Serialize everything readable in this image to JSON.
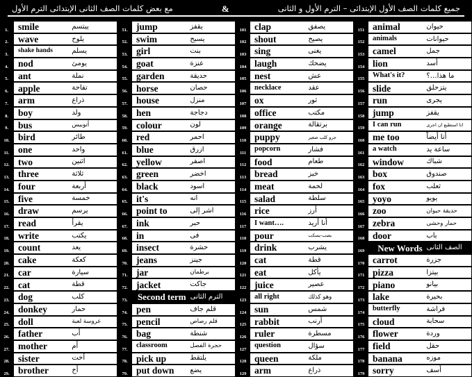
{
  "header": {
    "right_text": "جميع كلمات الصف الأول الإبتدائى – الترم الأول و الثانى",
    "amp": "&",
    "left_text": "مع بعض كلمات الصف الثانى الإبتدائى الترم الأول"
  },
  "colors": {
    "page_background": "#000000",
    "cell_background": "#ffffff",
    "text": "#000000",
    "inverse_text": "#ffffff"
  },
  "columns": [
    {
      "name": "column-1",
      "rows": [
        {
          "n": "1.",
          "en": "smile",
          "ar": "يبتسم"
        },
        {
          "n": "2.",
          "en": "wave",
          "ar": "يلوح"
        },
        {
          "n": "3.",
          "en": "shake hands",
          "ar": "يسلم",
          "en_size": "xs"
        },
        {
          "n": "4.",
          "en": "nod",
          "ar": "يومئ"
        },
        {
          "n": "5.",
          "en": "ant",
          "ar": "نملة"
        },
        {
          "n": "6.",
          "en": "apple",
          "ar": "تفاحة"
        },
        {
          "n": "7.",
          "en": "arm",
          "ar": "ذراع"
        },
        {
          "n": "8.",
          "en": "boy",
          "ar": "ولد"
        },
        {
          "n": "9.",
          "en": "bus",
          "ar": "أتوبيس",
          "ar_size": "sm"
        },
        {
          "n": "10.",
          "en": "bird",
          "ar": "طائر"
        },
        {
          "n": "11.",
          "en": "one",
          "ar": "واحد"
        },
        {
          "n": "12.",
          "en": "two",
          "ar": "اثنين"
        },
        {
          "n": "13.",
          "en": "three",
          "ar": "ثلاثة"
        },
        {
          "n": "14.",
          "en": "four",
          "ar": "أربعة"
        },
        {
          "n": "15.",
          "en": "five",
          "ar": "خمسة"
        },
        {
          "n": "16.",
          "en": "draw",
          "ar": "يرسم"
        },
        {
          "n": "17.",
          "en": "read",
          "ar": "يقرأ"
        },
        {
          "n": "18.",
          "en": "write",
          "ar": "يكتب"
        },
        {
          "n": "19.",
          "en": "count",
          "ar": "يعد"
        },
        {
          "n": "20.",
          "en": "cake",
          "ar": "كعكة"
        },
        {
          "n": "21.",
          "en": "car",
          "ar": "سيارة"
        },
        {
          "n": "22.",
          "en": "cat",
          "ar": "قطة"
        },
        {
          "n": "23.",
          "en": "dog",
          "ar": "كلب"
        },
        {
          "n": "24.",
          "en": "donkey",
          "ar": "حمار"
        },
        {
          "n": "25.",
          "en": "doll",
          "ar": "عروسة لعبة",
          "ar_size": "sm"
        },
        {
          "n": "26.",
          "en": "father",
          "ar": "أب"
        },
        {
          "n": "27.",
          "en": "mother",
          "ar": "أم"
        },
        {
          "n": "28.",
          "en": "sister",
          "ar": "أخت"
        },
        {
          "n": "29.",
          "en": "brother",
          "ar": "أخ"
        }
      ]
    },
    {
      "name": "column-2",
      "rows": [
        {
          "n": "51.",
          "en": "jump",
          "ar": "يقفز"
        },
        {
          "n": "52.",
          "en": "swim",
          "ar": "يسبح"
        },
        {
          "n": "53.",
          "en": "girl",
          "ar": "بنت"
        },
        {
          "n": "54.",
          "en": "goat",
          "ar": "عنزة"
        },
        {
          "n": "55.",
          "en": "garden",
          "ar": "حديقة"
        },
        {
          "n": "56.",
          "en": "horse",
          "ar": "حصان"
        },
        {
          "n": "57.",
          "en": "house",
          "ar": "منزل"
        },
        {
          "n": "58.",
          "en": "hen",
          "ar": "دجاجة"
        },
        {
          "n": "59.",
          "en": "colour",
          "ar": "لون"
        },
        {
          "n": "60.",
          "en": "red",
          "ar": "احمر"
        },
        {
          "n": "61.",
          "en": "blue",
          "ar": "ازرق"
        },
        {
          "n": "62.",
          "en": "yellow",
          "ar": "اصفر"
        },
        {
          "n": "63.",
          "en": "green",
          "ar": "اخضر"
        },
        {
          "n": "64.",
          "en": "black",
          "ar": "اسود"
        },
        {
          "n": "65.",
          "en": "it's",
          "ar": "انه"
        },
        {
          "n": "66.",
          "en": "point to",
          "ar": "اشر إلى"
        },
        {
          "n": "67.",
          "en": "ink",
          "ar": "حبر"
        },
        {
          "n": "68.",
          "en": "in",
          "ar": "فى"
        },
        {
          "n": "69.",
          "en": "insect",
          "ar": "حشرة"
        },
        {
          "n": "70.",
          "en": "jeans",
          "ar": "جينز"
        },
        {
          "n": "71.",
          "en": "jar",
          "ar": "برطمان",
          "ar_size": "sm"
        },
        {
          "n": "72.",
          "en": "jacket",
          "ar": "جاكت"
        },
        {
          "n": "73.",
          "en": "Second term",
          "ar": "الترم الثانى",
          "section": true
        },
        {
          "n": "74.",
          "en": "pen",
          "ar": "قلم جاف"
        },
        {
          "n": "75.",
          "en": "pencil",
          "ar": "قلم رصاص",
          "ar_size": "sm"
        },
        {
          "n": "76.",
          "en": "bag",
          "ar": "شنطة"
        },
        {
          "n": "77.",
          "en": "classroom",
          "ar": "حجرة الفصل",
          "en_size": "sm",
          "ar_size": "sm"
        },
        {
          "n": "78.",
          "en": "pick up",
          "ar": "يلتقط"
        },
        {
          "n": "79.",
          "en": "put down",
          "ar": "يضع"
        }
      ]
    },
    {
      "name": "column-3",
      "rows": [
        {
          "n": "101",
          "en": "clap",
          "ar": "يصفق"
        },
        {
          "n": "102",
          "en": "shout",
          "ar": "يصيح"
        },
        {
          "n": "103",
          "en": "sing",
          "ar": "يغنى"
        },
        {
          "n": "104",
          "en": "laugh",
          "ar": "يضحك"
        },
        {
          "n": "105",
          "en": "nest",
          "ar": "عش"
        },
        {
          "n": "106",
          "en": "necklace",
          "ar": "عقد",
          "en_size": "sm"
        },
        {
          "n": "107",
          "en": "ox",
          "ar": "ثور"
        },
        {
          "n": "108",
          "en": "office",
          "ar": "مكتب"
        },
        {
          "n": "109",
          "en": "orange",
          "ar": "برتقالة"
        },
        {
          "n": "110",
          "en": "puppy",
          "ar": "جرو كلب صغير",
          "ar_size": "xs"
        },
        {
          "n": "111",
          "en": "popcorn",
          "ar": "فشار",
          "en_size": "sm"
        },
        {
          "n": "112",
          "en": "food",
          "ar": "طعام"
        },
        {
          "n": "113",
          "en": "bread",
          "ar": "خبز"
        },
        {
          "n": "114",
          "en": "meat",
          "ar": "لحمة"
        },
        {
          "n": "115",
          "en": "salad",
          "ar": "سلطة"
        },
        {
          "n": "116",
          "en": "rice",
          "ar": "أرز"
        },
        {
          "n": "117",
          "en": "I want….",
          "ar": "أنا أريد",
          "en_size": "sm"
        },
        {
          "n": "118",
          "en": "pour",
          "ar": "يصب-يسكب",
          "ar_size": "xs"
        },
        {
          "n": "119",
          "en": "drink",
          "ar": "يشرب"
        },
        {
          "n": "120",
          "en": "cat",
          "ar": "قطة"
        },
        {
          "n": "121",
          "en": "eat",
          "ar": "يأكل"
        },
        {
          "n": "122",
          "en": "juice",
          "ar": "عصير"
        },
        {
          "n": "123",
          "en": "all right",
          "ar": "وهو كذلك",
          "en_size": "sm",
          "ar_size": "sm"
        },
        {
          "n": "124",
          "en": "sun",
          "ar": "شمس"
        },
        {
          "n": "125",
          "en": "rabbit",
          "ar": "أرنب"
        },
        {
          "n": "126",
          "en": "ruler",
          "ar": "مسطرة"
        },
        {
          "n": "127",
          "en": "question",
          "ar": "سؤال",
          "en_size": "sm"
        },
        {
          "n": "128",
          "en": "queen",
          "ar": "ملكة"
        },
        {
          "n": "129",
          "en": "arm",
          "ar": "ذراع"
        }
      ]
    },
    {
      "name": "column-4",
      "rows": [
        {
          "n": "151",
          "en": "animal",
          "ar": "حيوان"
        },
        {
          "n": "152",
          "en": "animals",
          "ar": "حيوانات",
          "en_size": "sm"
        },
        {
          "n": "153",
          "en": "camel",
          "ar": "جمل"
        },
        {
          "n": "154",
          "en": "lion",
          "ar": "أسد"
        },
        {
          "n": "155",
          "en": "What's it?",
          "ar": "ما هذا…؟",
          "en_size": "sm"
        },
        {
          "n": "156",
          "en": "slide",
          "ar": "يتزحلق"
        },
        {
          "n": "157",
          "en": "run",
          "ar": "يجرى"
        },
        {
          "n": "158",
          "en": "jump",
          "ar": "يقفز"
        },
        {
          "n": "159",
          "en": "I can run",
          "ar": "انا استطيع ان اجرى",
          "en_size": "sm",
          "ar_size": "xs"
        },
        {
          "n": "160",
          "en": "me too",
          "ar": "أنا أيضاً"
        },
        {
          "n": "161",
          "en": "a watch",
          "ar": "ساعة يد",
          "en_size": "sm"
        },
        {
          "n": "162",
          "en": "window",
          "ar": "شباك"
        },
        {
          "n": "163",
          "en": "box",
          "ar": "صندوق"
        },
        {
          "n": "164",
          "en": "fox",
          "ar": "ثعلب"
        },
        {
          "n": "165",
          "en": "yoyo",
          "ar": "يويو"
        },
        {
          "n": "166",
          "en": "zoo",
          "ar": "حديقة حيوان",
          "ar_size": "sm"
        },
        {
          "n": "167",
          "en": "zebra",
          "ar": "حمار وحشى",
          "ar_size": "sm"
        },
        {
          "n": "168",
          "en": "door",
          "ar": "باب"
        },
        {
          "n": "169",
          "en": "New Words",
          "ar": "الصف الثانى",
          "section": true
        },
        {
          "n": "170",
          "en": "carrot",
          "ar": "جزرة"
        },
        {
          "n": "171",
          "en": "pizza",
          "ar": "بيتزا"
        },
        {
          "n": "172",
          "en": "piano",
          "ar": "بيانو"
        },
        {
          "n": "173",
          "en": "lake",
          "ar": "بحيرة"
        },
        {
          "n": "174",
          "en": "butterfly",
          "ar": "فراشة",
          "en_size": "sm"
        },
        {
          "n": "175",
          "en": "cloud",
          "ar": "سحابة"
        },
        {
          "n": "176",
          "en": "flower",
          "ar": "وردة"
        },
        {
          "n": "177",
          "en": "field",
          "ar": "حقل"
        },
        {
          "n": "178",
          "en": "banana",
          "ar": "موزه"
        },
        {
          "n": "179",
          "en": "sorry",
          "ar": "أسف"
        }
      ]
    }
  ]
}
